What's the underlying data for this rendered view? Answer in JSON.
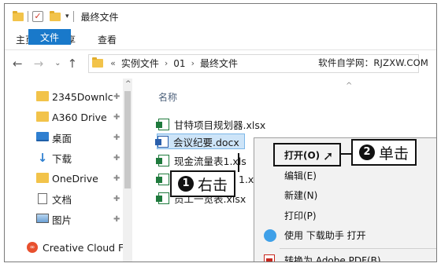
{
  "window": {
    "title": "最终文件",
    "quick_access_dropdown": "▾"
  },
  "ribbon": {
    "tabs": [
      "文件",
      "主页",
      "共享",
      "查看"
    ]
  },
  "address": {
    "back": "←",
    "forward": "→",
    "recent": "⌄",
    "up": "↑",
    "overflow": "«",
    "crumbs": [
      "实例文件",
      "01",
      "最终文件"
    ],
    "separator": "›"
  },
  "watermark": "软件自学网：RJZXW.COM",
  "sidebar": {
    "items": [
      {
        "label": "2345Downlc",
        "icon": "folder-icon",
        "pinned": true
      },
      {
        "label": "A360 Drive",
        "icon": "folder-icon",
        "pinned": true
      },
      {
        "label": "桌面",
        "icon": "desktop-icon",
        "pinned": true
      },
      {
        "label": "下载",
        "icon": "download-icon",
        "pinned": true
      },
      {
        "label": "OneDrive",
        "icon": "folder-icon",
        "pinned": true
      },
      {
        "label": "文档",
        "icon": "document-icon",
        "pinned": true
      },
      {
        "label": "图片",
        "icon": "pictures-icon",
        "pinned": true
      },
      {
        "label": "Creative Cloud F",
        "icon": "creative-cloud-icon",
        "pinned": false
      }
    ],
    "pin_glyph": "✚",
    "scroll_up": "^"
  },
  "filelist": {
    "column_name": "名称",
    "sort_glyph": "^",
    "files": [
      {
        "name": "甘特项目规划器.xlsx",
        "type": "excel"
      },
      {
        "name": "会议纪要.docx",
        "type": "word",
        "selected": true
      },
      {
        "name": "现金流量表1.xls",
        "type": "excel"
      },
      {
        "name": "1.x",
        "type": "excel"
      },
      {
        "name": "员工一览表.xlsx",
        "type": "excel"
      }
    ]
  },
  "context_menu": {
    "items": [
      {
        "label": "打开(O)",
        "bold": true,
        "icon": ""
      },
      {
        "label": "编辑(E)",
        "bold": false,
        "icon": ""
      },
      {
        "label": "新建(N)",
        "bold": false,
        "icon": ""
      },
      {
        "label": "打印(P)",
        "bold": false,
        "icon": ""
      },
      {
        "label": "使用 下载助手 打开",
        "bold": false,
        "icon": "download-assistant-icon"
      },
      {
        "label": "转换为 Adobe PDF(B)",
        "bold": false,
        "icon": "adobe-pdf-icon"
      }
    ]
  },
  "callouts": {
    "step1": {
      "number": "1",
      "text": "右击"
    },
    "step2": {
      "number": "2",
      "text": "单击"
    }
  },
  "colors": {
    "file_tab_bg": "#1979ca",
    "selection_bg": "#cde4f8",
    "menu_bg": "#f2f2f2"
  }
}
